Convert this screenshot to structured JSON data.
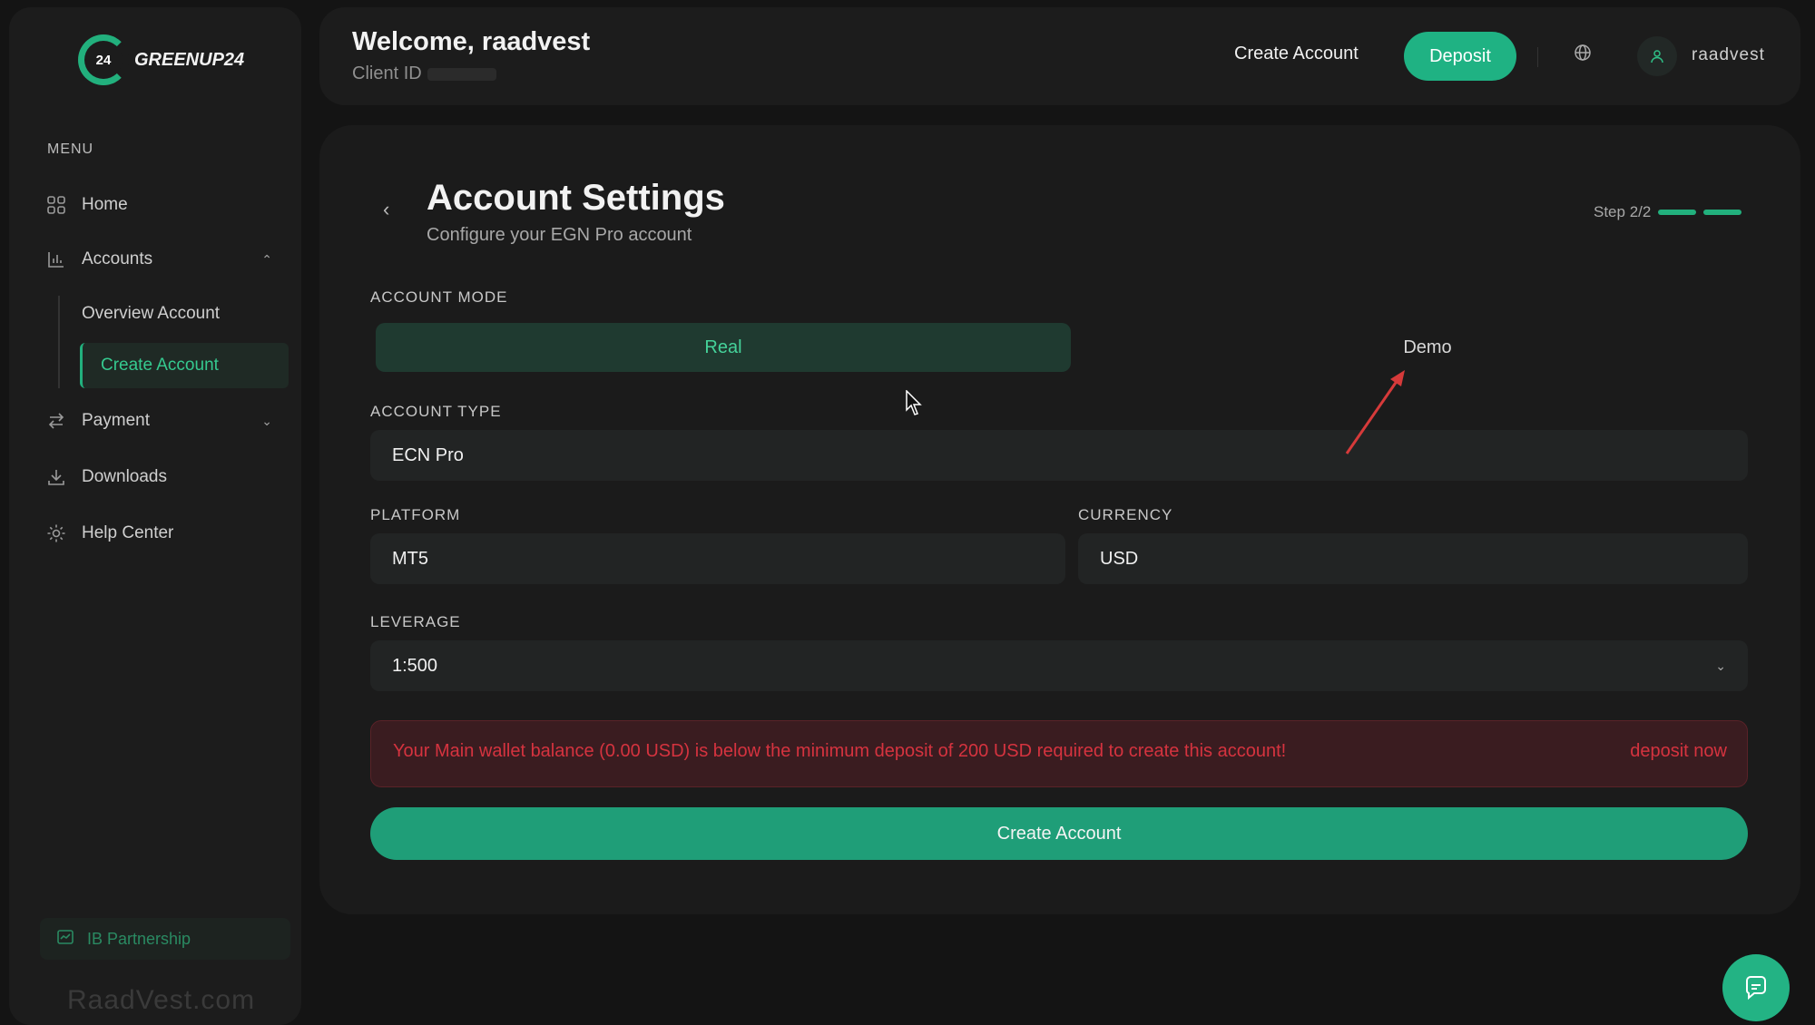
{
  "sidebar": {
    "logo_badge": "24",
    "logo_text": "GREENUP24",
    "menu_title": "MENU",
    "items": [
      {
        "label": "Home",
        "icon": "grid-icon"
      },
      {
        "label": "Accounts",
        "icon": "chart-icon"
      },
      {
        "label": "Payment",
        "icon": "transfer-icon"
      },
      {
        "label": "Downloads",
        "icon": "download-icon"
      },
      {
        "label": "Help Center",
        "icon": "gear-icon"
      }
    ],
    "sub_items": [
      {
        "label": "Overview Account"
      },
      {
        "label": "Create Account",
        "active": true
      }
    ],
    "ib_label": "IB Partnership",
    "watermark": "RaadVest.com"
  },
  "header": {
    "welcome": "Welcome, raadvest",
    "client_id_label": "Client ID",
    "create_account": "Create Account",
    "deposit": "Deposit",
    "username": "raadvest"
  },
  "main": {
    "title": "Account Settings",
    "subtitle": "Configure your EGN Pro account",
    "step": "Step 2/2",
    "account_mode_label": "ACCOUNT MODE",
    "mode_real": "Real",
    "mode_demo": "Demo",
    "account_type_label": "ACCOUNT TYPE",
    "account_type_value": "ECN Pro",
    "platform_label": "PLATFORM",
    "platform_value": "MT5",
    "currency_label": "CURRENCY",
    "currency_value": "USD",
    "leverage_label": "LEVERAGE",
    "leverage_value": "1:500",
    "alert_message": "Your Main wallet balance (0.00 USD) is below the minimum deposit of 200 USD required to create this account!",
    "alert_link": "deposit now",
    "create_button": "Create Account"
  },
  "colors": {
    "accent": "#22b07d",
    "background": "#141414",
    "card": "#1b1b1b",
    "alert": "#d5333f"
  }
}
